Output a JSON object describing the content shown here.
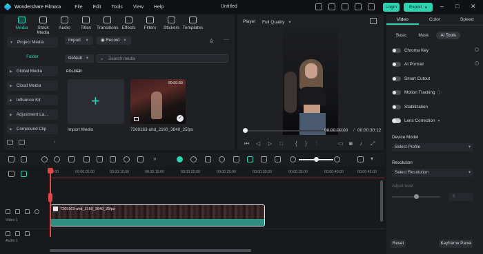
{
  "app": {
    "name": "Wondershare Filmora",
    "doc_title": "Untitled",
    "login": "Login",
    "export": "Export"
  },
  "menu": [
    "File",
    "Edit",
    "Tools",
    "View",
    "Help"
  ],
  "media_tabs": [
    {
      "label": "Media",
      "active": true
    },
    {
      "label": "Stock Media"
    },
    {
      "label": "Audio"
    },
    {
      "label": "Titles"
    },
    {
      "label": "Transitions"
    },
    {
      "label": "Effects"
    },
    {
      "label": "Filters"
    },
    {
      "label": "Stickers"
    },
    {
      "label": "Templates"
    }
  ],
  "left_nav": {
    "project_media": "Project Media",
    "folder": "Folder",
    "items": [
      "Global Media",
      "Cloud Media",
      "Influence Kit",
      "Adjustment La...",
      "Compound Clip"
    ]
  },
  "media_toolbar": {
    "import": "Import",
    "record": "Record",
    "default": "Default",
    "search_placeholder": "Search media"
  },
  "media_content": {
    "folder_label": "FOLDER",
    "import_media": "Import Media",
    "clip_name": "7269163-uhd_2160_3840_25fps",
    "clip_duration": "00:00:30"
  },
  "player": {
    "label": "Player",
    "quality": "Full Quality",
    "current_time": "00:00:00:00",
    "separator": "/",
    "total_time": "00:00:30:12"
  },
  "props": {
    "tabs": [
      {
        "label": "Video",
        "active": true
      },
      {
        "label": "Color"
      },
      {
        "label": "Speed"
      }
    ],
    "subtabs": [
      {
        "label": "Basic"
      },
      {
        "label": "Mask"
      },
      {
        "label": "AI Tools",
        "active": true
      }
    ],
    "features": [
      "Chroma Key",
      "AI Portrait",
      "Smart Cutout",
      "Motion Tracking",
      "Stabilization",
      "Lens Correction"
    ],
    "device_model_label": "Device Model",
    "device_model_value": "Select Profile",
    "resolution_label": "Resolution",
    "resolution_value": "Select Resolution",
    "adjust_level_label": "Adjust level",
    "adjust_level_value": "0",
    "reset": "Reset",
    "keyframe": "Keyframe Panel"
  },
  "timeline": {
    "ticks": [
      "00:00",
      "00:00:05:00",
      "00:00:10:00",
      "00:00:15:00",
      "00:00:20:00",
      "00:00:25:00",
      "00:00:30:00",
      "00:00:35:00",
      "00:00:40:00",
      "00:00:45:00"
    ],
    "video_track": "Video 1",
    "audio_track": "Audio 1",
    "clip_label": "7269163-uhd_2160_3840_25fps"
  },
  "colors": {
    "accent": "#2ed3b2",
    "playhead": "#e04848",
    "panel_bg": "#1f2024",
    "app_bg": "#18191c"
  }
}
